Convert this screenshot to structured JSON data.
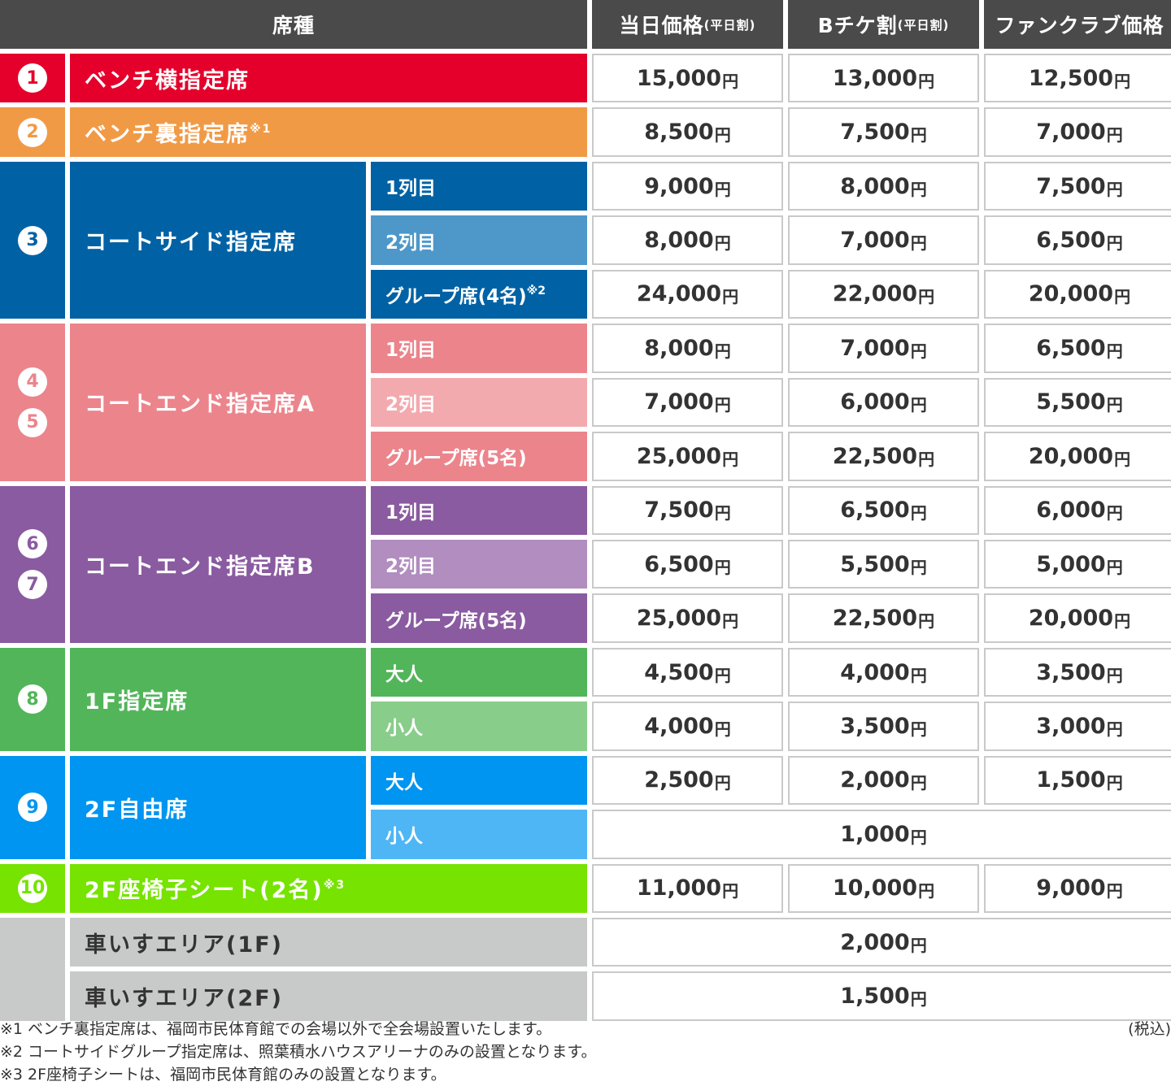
{
  "header": {
    "seat_type": "席種",
    "col1": {
      "label": "当日価格",
      "note": "(平日割)"
    },
    "col2": {
      "label": "Bチケ割",
      "note": "(平日割)"
    },
    "col3": {
      "label": "ファンクラブ価格",
      "note": ""
    }
  },
  "currency": "円",
  "colors": {
    "header": "#4a4a4a",
    "bench_side": "#e4002b",
    "bench_back": "#f19a46",
    "court_side": "#0062a5",
    "court_side_row2": "#4e97c9",
    "court_end_a": "#ec848c",
    "court_end_a_row2": "#f3aaaf",
    "court_end_b": "#8a5ba0",
    "court_end_b_row2": "#b18dc0",
    "floor1": "#52b55a",
    "floor1_row2": "#89cd8b",
    "floor2_free": "#0095f0",
    "floor2_free_row2": "#4fb6f6",
    "floor2_sofa": "#76e300",
    "wheelchair": "#c8c9c9"
  },
  "rows": [
    {
      "num": "1",
      "name": "ベンチ横指定席",
      "prices": [
        "15,000",
        "13,000",
        "12,500"
      ]
    },
    {
      "num": "2",
      "name": "ベンチ裏指定席",
      "name_sup": "※1",
      "prices": [
        "8,500",
        "7,500",
        "7,000"
      ]
    },
    {
      "num": "3",
      "name": "コートサイド指定席",
      "subs": [
        {
          "label": "1列目",
          "prices": [
            "9,000",
            "8,000",
            "7,500"
          ]
        },
        {
          "label": "2列目",
          "prices": [
            "8,000",
            "7,000",
            "6,500"
          ]
        },
        {
          "label": "グループ席",
          "label_small": "(4名)",
          "label_sup": "※2",
          "prices": [
            "24,000",
            "22,000",
            "20,000"
          ]
        }
      ]
    },
    {
      "nums": [
        "4",
        "5"
      ],
      "name": "コートエンド指定席A",
      "subs": [
        {
          "label": "1列目",
          "prices": [
            "8,000",
            "7,000",
            "6,500"
          ]
        },
        {
          "label": "2列目",
          "prices": [
            "7,000",
            "6,000",
            "5,500"
          ]
        },
        {
          "label": "グループ席",
          "label_small": "(5名)",
          "prices": [
            "25,000",
            "22,500",
            "20,000"
          ]
        }
      ]
    },
    {
      "nums": [
        "6",
        "7"
      ],
      "name": "コートエンド指定席B",
      "subs": [
        {
          "label": "1列目",
          "prices": [
            "7,500",
            "6,500",
            "6,000"
          ]
        },
        {
          "label": "2列目",
          "prices": [
            "6,500",
            "5,500",
            "5,000"
          ]
        },
        {
          "label": "グループ席",
          "label_small": "(5名)",
          "prices": [
            "25,000",
            "22,500",
            "20,000"
          ]
        }
      ]
    },
    {
      "num": "8",
      "name": "1F指定席",
      "subs": [
        {
          "label": "大人",
          "prices": [
            "4,500",
            "4,000",
            "3,500"
          ]
        },
        {
          "label": "小人",
          "prices": [
            "4,000",
            "3,500",
            "3,000"
          ]
        }
      ]
    },
    {
      "num": "9",
      "name": "2F自由席",
      "subs": [
        {
          "label": "大人",
          "prices": [
            "2,500",
            "2,000",
            "1,500"
          ]
        },
        {
          "label": "小人",
          "price_all": "1,000"
        }
      ]
    },
    {
      "num": "10",
      "name": "2F座椅子シート",
      "name_small": "(2名)",
      "name_sup": "※3",
      "prices": [
        "11,000",
        "10,000",
        "9,000"
      ]
    },
    {
      "name": "車いすエリア(1F)",
      "price_all": "2,000"
    },
    {
      "name": "車いすエリア(2F)",
      "price_all": "1,500"
    }
  ],
  "notes": [
    "※1 ベンチ裏指定席は、福岡市民体育館での会場以外で全会場設置いたします。",
    "※2 コートサイドグループ指定席は、照葉積水ハウスアリーナのみの設置となります。",
    "※3 2F座椅子シートは、福岡市民体育館のみの設置となります。"
  ],
  "tax_note": "(税込)"
}
